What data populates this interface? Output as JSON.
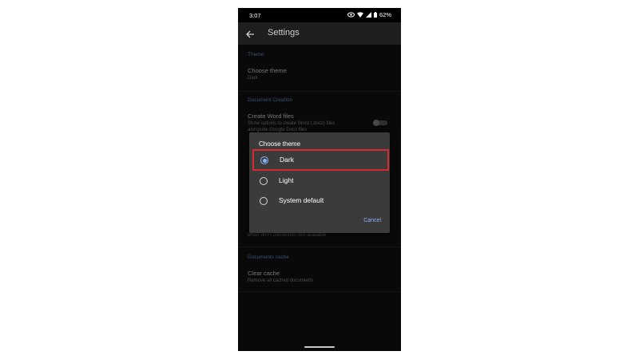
{
  "status_bar": {
    "time": "3:07",
    "battery": "62%",
    "icons": [
      "eye-icon",
      "wifi-icon",
      "signal-icon",
      "battery-icon"
    ]
  },
  "app_bar": {
    "title": "Settings",
    "back_icon": "arrow-back-icon"
  },
  "settings": {
    "theme_section": {
      "header": "Theme",
      "item_title": "Choose theme",
      "item_value": "Dark"
    },
    "doc_creation_section": {
      "header": "Document Creation",
      "item_title": "Create Word files",
      "item_sub_1": "Show options to create Word (.docx) files",
      "item_sub_2": "alongside Google Docs files",
      "toggle_on": false
    },
    "partial_line": "when Wi-Fi connection isn't available.",
    "cache_section": {
      "header": "Documents cache",
      "item_title": "Clear cache",
      "item_sub": "Remove all cached documents"
    }
  },
  "dialog": {
    "title": "Choose theme",
    "options": [
      {
        "label": "Dark",
        "selected": true
      },
      {
        "label": "Light",
        "selected": false
      },
      {
        "label": "System default",
        "selected": false
      }
    ],
    "cancel_label": "Cancel"
  },
  "colors": {
    "accent": "#8ab4f8",
    "highlight_box": "#d62a32",
    "background": "#121212",
    "dialog": "#3b3b3b"
  }
}
